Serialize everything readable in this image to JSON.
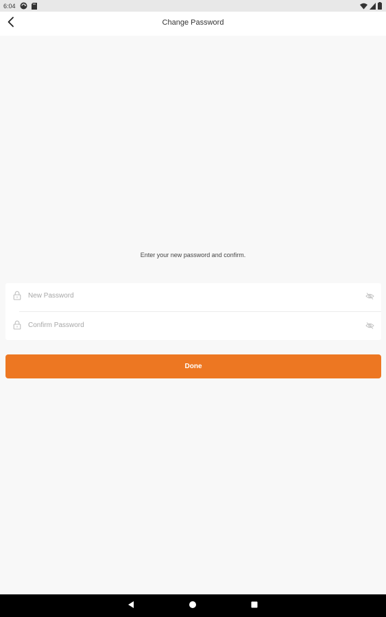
{
  "status_bar": {
    "time": "6:04",
    "icons": [
      "sync-icon",
      "sd-card-icon",
      "wifi-icon",
      "signal-icon",
      "battery-icon"
    ]
  },
  "header": {
    "title": "Change Password",
    "back_icon": "chevron-left-icon"
  },
  "main": {
    "instruction": "Enter your new password and confirm.",
    "fields": [
      {
        "placeholder": "New Password",
        "value": "",
        "leading_icon": "lock-icon",
        "trailing_icon": "eye-hidden-icon"
      },
      {
        "placeholder": "Confirm Password",
        "value": "",
        "leading_icon": "lock-icon",
        "trailing_icon": "eye-hidden-icon"
      }
    ],
    "done_label": "Done"
  },
  "nav_bar": {
    "icons": [
      "nav-back-icon",
      "nav-home-icon",
      "nav-recents-icon"
    ]
  },
  "colors": {
    "accent": "#ed7722",
    "background": "#f8f8f8",
    "card": "#ffffff",
    "placeholder": "#a7a7a7",
    "status_bar": "#e8e8e8",
    "nav_bar": "#000000"
  }
}
